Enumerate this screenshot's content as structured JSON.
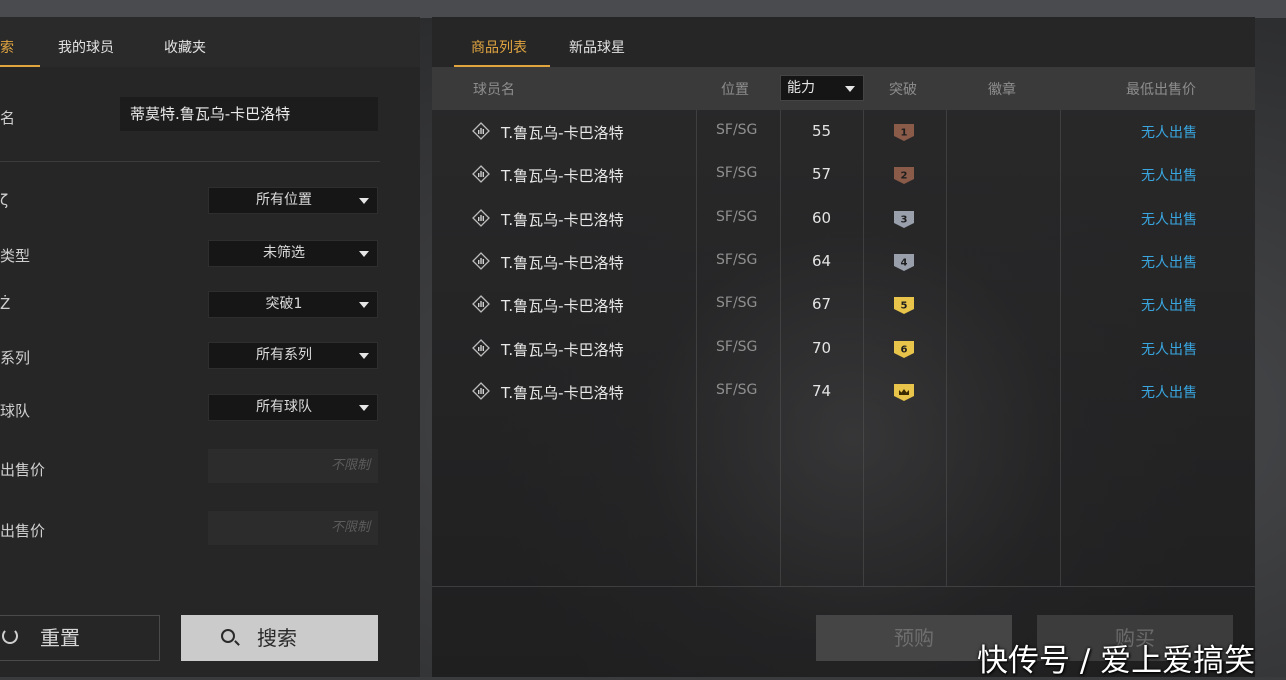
{
  "left_tabs": [
    "索",
    "我的球员",
    "收藏夹"
  ],
  "filters": {
    "name_label": "名",
    "name_value": "蒂莫特.鲁瓦乌-卡巴洛特",
    "position_label": "ζ",
    "position_value": "所有位置",
    "type_label": "类型",
    "type_value": "未筛选",
    "breakthrough_label": "Ż",
    "breakthrough_value": "突破1",
    "series_label": "系列",
    "series_value": "所有系列",
    "team_label": "球队",
    "team_value": "所有球队",
    "min_price_label": "出售价",
    "min_price_placeholder": "不限制",
    "max_price_label": "出售价",
    "max_price_placeholder": "不限制"
  },
  "buttons": {
    "reset": "重置",
    "search": "搜索",
    "prebuy": "预购",
    "buy": "购买"
  },
  "right_tabs": [
    "商品列表",
    "新品球星"
  ],
  "table_headers": {
    "player": "球员名",
    "position": "位置",
    "ability": "能力",
    "breakthrough": "突破",
    "badge": "徽章",
    "min_price": "最低出售价"
  },
  "rows": [
    {
      "name": "T.鲁瓦乌-卡巴洛特",
      "position": "SF/SG",
      "ability": "55",
      "breakthrough": "1",
      "badge_color": "#8a5b49",
      "price": "无人出售"
    },
    {
      "name": "T.鲁瓦乌-卡巴洛特",
      "position": "SF/SG",
      "ability": "57",
      "breakthrough": "2",
      "badge_color": "#8a5b49",
      "price": "无人出售"
    },
    {
      "name": "T.鲁瓦乌-卡巴洛特",
      "position": "SF/SG",
      "ability": "60",
      "breakthrough": "3",
      "badge_color": "#9aa0ab",
      "price": "无人出售"
    },
    {
      "name": "T.鲁瓦乌-卡巴洛特",
      "position": "SF/SG",
      "ability": "64",
      "breakthrough": "4",
      "badge_color": "#9aa0ab",
      "price": "无人出售"
    },
    {
      "name": "T.鲁瓦乌-卡巴洛特",
      "position": "SF/SG",
      "ability": "67",
      "breakthrough": "5",
      "badge_color": "#e8c44a",
      "price": "无人出售"
    },
    {
      "name": "T.鲁瓦乌-卡巴洛特",
      "position": "SF/SG",
      "ability": "70",
      "breakthrough": "6",
      "badge_color": "#e8c44a",
      "price": "无人出售"
    },
    {
      "name": "T.鲁瓦乌-卡巴洛特",
      "position": "SF/SG",
      "ability": "74",
      "breakthrough": "crown",
      "badge_color": "#e8c44a",
      "price": "无人出售"
    }
  ],
  "watermark": "快传号 / 爱上爱搞笑"
}
